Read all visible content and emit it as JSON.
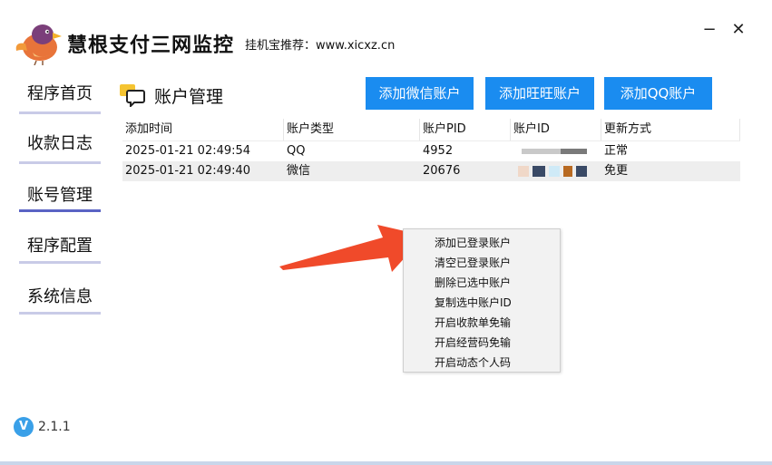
{
  "app": {
    "title": "慧根支付三网监控",
    "promo": "挂机宝推荐：www.xicxz.cn",
    "minimize_glyph": "−",
    "close_glyph": "✕",
    "logo_icon": "bird-logo-icon"
  },
  "sidebar": {
    "items": [
      {
        "label": "程序首页",
        "active": false
      },
      {
        "label": "收款日志",
        "active": false
      },
      {
        "label": "账号管理",
        "active": true
      },
      {
        "label": "程序配置",
        "active": false
      },
      {
        "label": "系统信息",
        "active": false
      }
    ]
  },
  "page": {
    "title": "账户管理",
    "icon": "chat-bubble-icon"
  },
  "toolbar": {
    "add_wechat": "添加微信账户",
    "add_wangwang": "添加旺旺账户",
    "add_qq": "添加QQ账户"
  },
  "table": {
    "headers": [
      "添加时间",
      "账户类型",
      "账户PID",
      "账户ID",
      "更新方式"
    ],
    "rows": [
      [
        "2025-01-21 02:49:54",
        "QQ",
        "4952",
        "",
        "正常"
      ],
      [
        "2025-01-21 02:49:40",
        "微信",
        "20676",
        "",
        "免更"
      ]
    ]
  },
  "context_menu": {
    "items": [
      "添加已登录账户",
      "清空已登录账户",
      "删除已选中账户",
      "复制选中账户ID",
      "开启收款单免输",
      "开启经营码免输",
      "开启动态个人码"
    ]
  },
  "version": {
    "badge": "V",
    "text": "2.1.1"
  },
  "colors": {
    "accent": "#1a8cf0",
    "active_nav_bar": "#5a63c4",
    "nav_bar": "#c9cbe7",
    "arrow": "#f04a2a"
  }
}
